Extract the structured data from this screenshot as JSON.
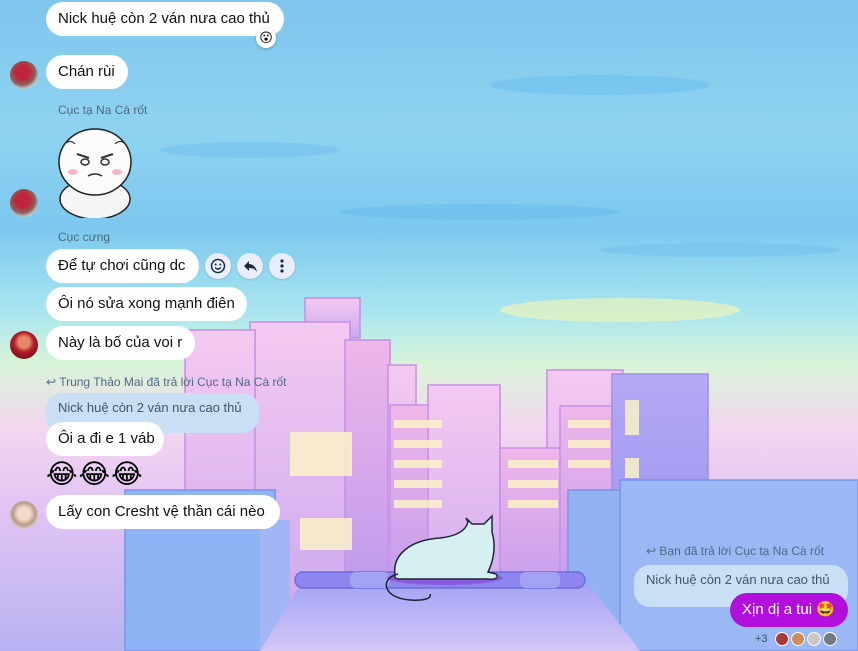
{
  "messages": {
    "m1": {
      "text": "Nick huệ còn 2 ván nưa cao thủ",
      "reaction": "😮"
    },
    "m2": {
      "text": "Chán rùi"
    },
    "m3": {
      "sender": "Cục tạ Na Cà rốt"
    },
    "m4": {
      "sender": "Cục cưng",
      "text": "Để tự chơi cũng dc"
    },
    "m5": {
      "text": "Ôi nó sửa xong mạnh điên"
    },
    "m6": {
      "text": "Này là bố của voi r"
    },
    "m7": {
      "reply_info": "Trung Thảo Mai đã trả lời Cục tạ Na Cà rốt",
      "quoted": "Nick huệ còn 2 ván nưa cao thủ",
      "text": "Ôi a đi e 1 váb"
    },
    "m8": {
      "emojis": "😂😂😂"
    },
    "m9": {
      "text": "Lấy con Cresht vệ thần cái nèo"
    },
    "m10": {
      "reply_info": "Bạn đã trả lời Cục tạ Na Cà rốt",
      "quoted": "Nick huệ còn 2 ván nưa cao thủ",
      "text": "Xịn dị a tui 🤩"
    }
  },
  "actions": {
    "emoji_icon": "smile-icon",
    "reply_icon": "reply-icon",
    "more_icon": "more-vertical-icon"
  },
  "seen_by": {
    "more_count": "+3"
  },
  "colors": {
    "mine_bubble": "#b20fdc",
    "quote_bubble": "#c9dff6"
  }
}
